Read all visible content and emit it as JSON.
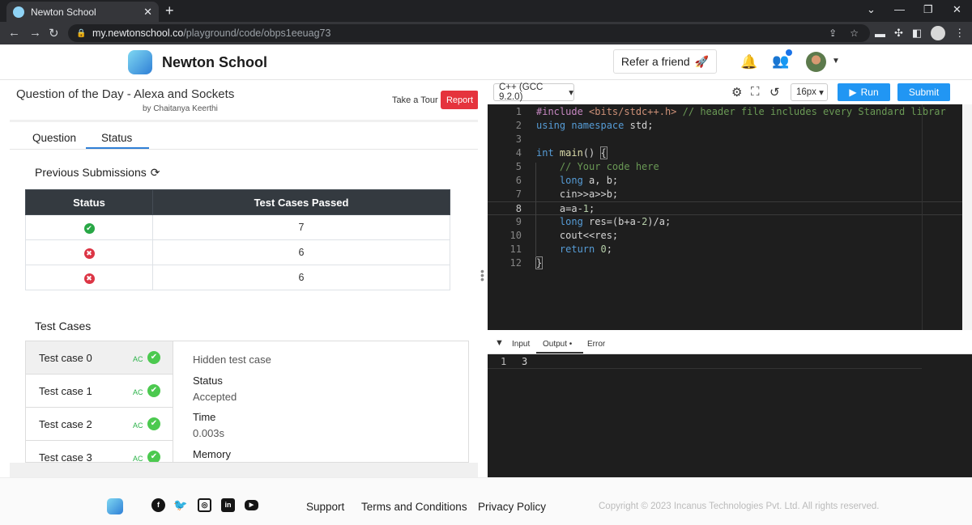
{
  "browser": {
    "tab_title": "Newton School",
    "close": "✕",
    "new_tab": "+",
    "url_host": "my.newtonschool.co",
    "url_path": "/playground/code/obps1eeuag73",
    "nav": {
      "back": "←",
      "forward": "→",
      "reload": "↻"
    },
    "window": {
      "min": "—",
      "restore": "❐",
      "close": "✕",
      "caret": "⌄"
    }
  },
  "header": {
    "brand": "Newton School",
    "refer_label": "Refer a friend",
    "refer_icon": "🚀"
  },
  "question": {
    "title": "Question of the Day - Alexa and Sockets",
    "author": "by Chaitanya Keerthi",
    "tour_label": "Take a Tour",
    "report_label": "Report",
    "tabs": [
      {
        "label": "Question"
      },
      {
        "label": "Status"
      }
    ],
    "active_tab": 1
  },
  "submissions": {
    "title": "Previous Submissions",
    "columns": [
      "Status",
      "Test Cases Passed"
    ],
    "rows": [
      {
        "status": "accepted",
        "icon": "✔",
        "passed": "7"
      },
      {
        "status": "rejected",
        "icon": "✖",
        "passed": "6"
      },
      {
        "status": "rejected",
        "icon": "✖",
        "passed": "6"
      }
    ]
  },
  "test_cases": {
    "title": "Test Cases",
    "items": [
      {
        "label": "Test case 0",
        "verdict": "AC",
        "check": "✔"
      },
      {
        "label": "Test case 1",
        "verdict": "AC",
        "check": "✔"
      },
      {
        "label": "Test case 2",
        "verdict": "AC",
        "check": "✔"
      },
      {
        "label": "Test case 3",
        "verdict": "AC",
        "check": "✔"
      }
    ],
    "detail": {
      "name": "Hidden test case",
      "status_label": "Status",
      "status_value": "Accepted",
      "time_label": "Time",
      "time_value": "0.003s",
      "memory_label": "Memory"
    }
  },
  "editor": {
    "language": "C++ (GCC 9.2.0)",
    "font_size": "16px",
    "run_label": "Run",
    "submit_label": "Submit",
    "line_numbers": [
      "1",
      "2",
      "3",
      "4",
      "5",
      "6",
      "7",
      "8",
      "9",
      "10",
      "11",
      "12"
    ],
    "lines": [
      "#include <bits/stdc++.h> // header file includes every Standard librar",
      "using namespace std;",
      "",
      "int main() {",
      "    // Your code here",
      "    long a, b;",
      "    cin>>a>>b;",
      "    a=a-1;",
      "    long res=(b+a-2)/a;",
      "    cout<<res;",
      "    return 0;",
      "}"
    ],
    "current_line": 8
  },
  "io": {
    "tabs": [
      "Input",
      "Output •",
      "Error"
    ],
    "output_line_number": "1",
    "output_value": "3"
  },
  "footer": {
    "links": [
      "Support",
      "Terms and Conditions",
      "Privacy Policy"
    ],
    "copyright": "Copyright © 2023 Incanus Technologies Pvt. Ltd. All rights reserved."
  }
}
